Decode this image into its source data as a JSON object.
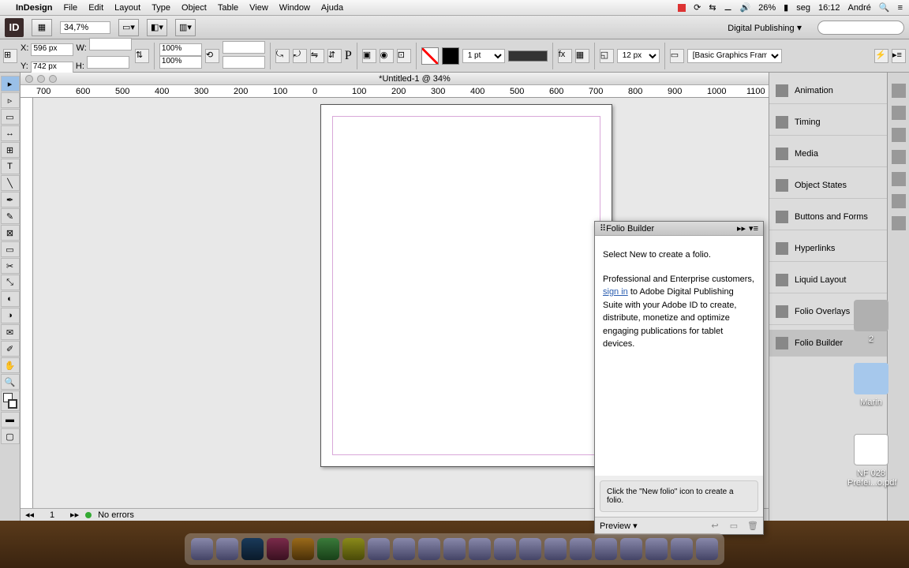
{
  "menubar": {
    "app": "InDesign",
    "items": [
      "File",
      "Edit",
      "Layout",
      "Type",
      "Object",
      "Table",
      "View",
      "Window",
      "Ajuda"
    ],
    "battery": "26%",
    "day": "seg",
    "time": "16:12",
    "user": "André"
  },
  "appbar": {
    "zoom": "34,7%",
    "workspace": "Digital Publishing"
  },
  "controlpanel": {
    "x": "596 px",
    "y": "742 px",
    "w": "",
    "h": "",
    "stroke_pt": "1 pt",
    "gap": "12 px",
    "style": "[Basic Graphics Frame]",
    "scale": "100%"
  },
  "doc": {
    "title": "*Untitled-1 @ 34%",
    "ruler_marks": [
      "700",
      "600",
      "500",
      "400",
      "300",
      "200",
      "100",
      "0",
      "100",
      "200",
      "300",
      "400",
      "500",
      "600",
      "700",
      "800",
      "900",
      "1000",
      "1100"
    ],
    "page": "1",
    "errors": "No errors"
  },
  "rightpanels": {
    "items": [
      "Animation",
      "Timing",
      "Media",
      "Object States",
      "Buttons and Forms",
      "Hyperlinks",
      "Liquid Layout",
      "Folio Overlays",
      "Folio Builder"
    ],
    "active": "Folio Builder"
  },
  "folio": {
    "title": "Folio Builder",
    "line1": "Select New to create a folio.",
    "line2a": "Professional and Enterprise customers, ",
    "link": "sign in",
    "line2b": " to Adobe Digital Publishing Suite with your Adobe ID to create, distribute, monetize and optimize engaging publications for tablet devices.",
    "hint": "Click the \"New folio\" icon to create a folio.",
    "preview": "Preview"
  },
  "desk": {
    "icon1": "Marin",
    "icon2": "NF 028 Prefei...o.pdf",
    "icon3": "2"
  }
}
